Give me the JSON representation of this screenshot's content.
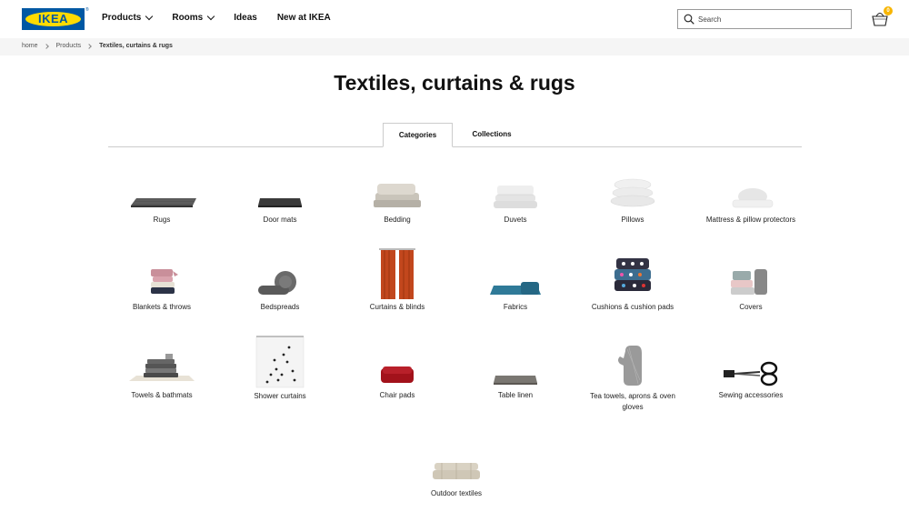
{
  "header": {
    "logo_text": "IKEA",
    "logo_reg": "®",
    "nav": [
      {
        "label": "Products",
        "dropdown": true
      },
      {
        "label": "Rooms",
        "dropdown": true
      },
      {
        "label": "Ideas",
        "dropdown": false
      },
      {
        "label": "New at IKEA",
        "dropdown": false
      }
    ],
    "search_placeholder": "Search",
    "cart_count": "0"
  },
  "breadcrumb": [
    "home",
    "Products",
    "Textiles, curtains & rugs"
  ],
  "page_title": "Textiles, curtains & rugs",
  "tabs": [
    {
      "label": "Categories",
      "active": true
    },
    {
      "label": "Collections",
      "active": false
    }
  ],
  "categories": [
    {
      "label": "Rugs",
      "icon": "rug-image"
    },
    {
      "label": "Door mats",
      "icon": "door-mat-image"
    },
    {
      "label": "Bedding",
      "icon": "bedding-image"
    },
    {
      "label": "Duvets",
      "icon": "duvet-image"
    },
    {
      "label": "Pillows",
      "icon": "pillow-image"
    },
    {
      "label": "Mattress & pillow protectors",
      "icon": "mattress-protector-image"
    },
    {
      "label": "Blankets & throws",
      "icon": "blanket-image"
    },
    {
      "label": "Bedspreads",
      "icon": "bedspread-image"
    },
    {
      "label": "Curtains & blinds",
      "icon": "curtain-image"
    },
    {
      "label": "Fabrics",
      "icon": "fabric-image"
    },
    {
      "label": "Cushions & cushion pads",
      "icon": "cushion-image"
    },
    {
      "label": "Covers",
      "icon": "cover-image"
    },
    {
      "label": "Towels & bathmats",
      "icon": "towel-image"
    },
    {
      "label": "Shower curtains",
      "icon": "shower-curtain-image"
    },
    {
      "label": "Chair pads",
      "icon": "chair-pad-image"
    },
    {
      "label": "Table linen",
      "icon": "table-linen-image"
    },
    {
      "label": "Tea towels, aprons & oven gloves",
      "icon": "oven-glove-image"
    },
    {
      "label": "Sewing accessories",
      "icon": "scissors-image"
    },
    {
      "label": "Outdoor textiles",
      "icon": "outdoor-textile-image"
    }
  ],
  "colors": {
    "brand_blue": "#0058a3",
    "brand_yellow": "#ffdb00",
    "badge": "#f7b500"
  }
}
